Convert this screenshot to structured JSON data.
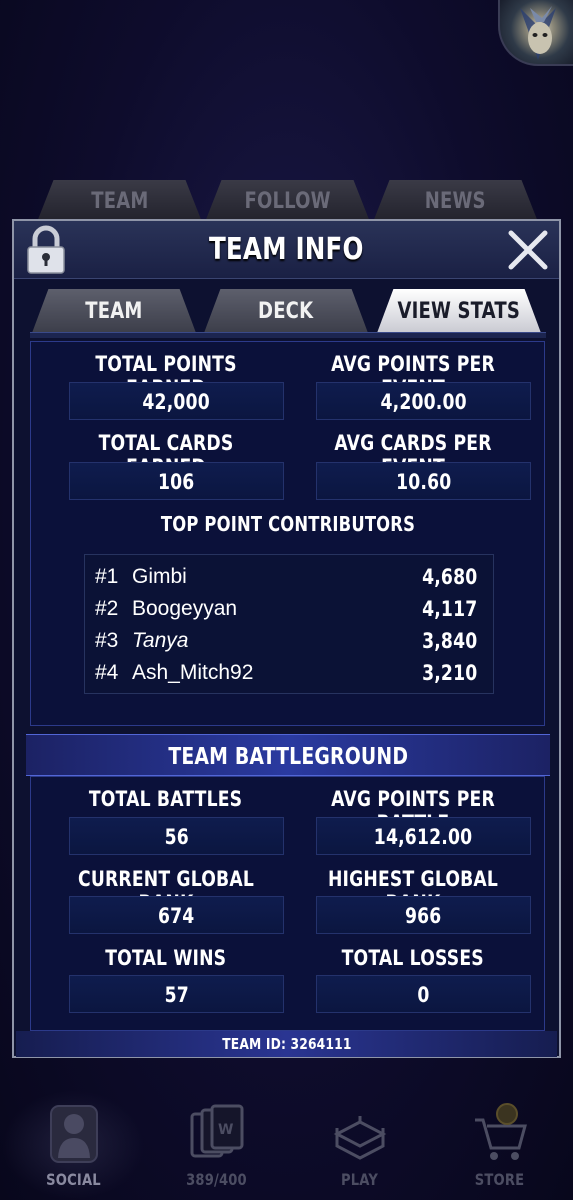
{
  "background_tabs": [
    "TEAM",
    "FOLLOW",
    "NEWS"
  ],
  "panel": {
    "title": "TEAM INFO",
    "tabs": [
      {
        "label": "TEAM",
        "active": false
      },
      {
        "label": "DECK",
        "active": false
      },
      {
        "label": "VIEW STATS",
        "active": true
      }
    ]
  },
  "stats": {
    "total_points_earned_label": "TOTAL POINTS EARNED",
    "total_points_earned": "42,000",
    "avg_points_per_event_label": "AVG POINTS PER EVENT",
    "avg_points_per_event": "4,200.00",
    "total_cards_earned_label": "TOTAL CARDS EARNED",
    "total_cards_earned": "106",
    "avg_cards_per_event_label": "AVG CARDS PER EVENT",
    "avg_cards_per_event": "10.60"
  },
  "contributors": {
    "title": "TOP POINT CONTRIBUTORS",
    "rows": [
      {
        "rank": "#1",
        "name": "Gimbi",
        "points": "4,680"
      },
      {
        "rank": "#2",
        "name": "Boogeyyan",
        "points": "4,117"
      },
      {
        "rank": "#3",
        "name": "Tanya",
        "points": "3,840"
      },
      {
        "rank": "#4",
        "name": "Ash_Mitch92",
        "points": "3,210"
      }
    ]
  },
  "battleground": {
    "title": "TEAM BATTLEGROUND",
    "total_battles_label": "TOTAL BATTLES",
    "total_battles": "56",
    "avg_points_per_battle_label": "AVG POINTS PER BATTLE",
    "avg_points_per_battle": "14,612.00",
    "current_global_rank_label": "CURRENT GLOBAL RANK",
    "current_global_rank": "674",
    "highest_global_rank_label": "HIGHEST GLOBAL RANK",
    "highest_global_rank": "966",
    "total_wins_label": "TOTAL WINS",
    "total_wins": "57",
    "total_losses_label": "TOTAL LOSSES",
    "total_losses": "0"
  },
  "team_id": "TEAM ID: 3264111",
  "bottom_nav": [
    {
      "label": "SOCIAL",
      "icon": "social-icon",
      "active": true
    },
    {
      "label": "389/400",
      "icon": "cards-icon",
      "active": false
    },
    {
      "label": "PLAY",
      "icon": "ring-icon",
      "active": false
    },
    {
      "label": "STORE",
      "icon": "cart-icon",
      "active": false
    }
  ]
}
